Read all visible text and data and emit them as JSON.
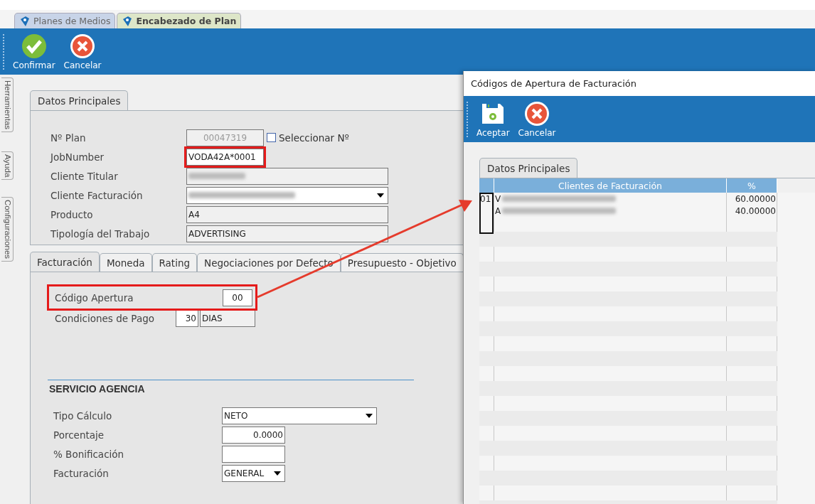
{
  "document_tabs": [
    {
      "label": "Planes de Medios",
      "selected": false
    },
    {
      "label": "Encabezado de Plan",
      "selected": true
    }
  ],
  "toolbar": [
    {
      "label": "Confirmar",
      "kind": "confirm"
    },
    {
      "label": "Cancelar",
      "kind": "cancel"
    }
  ],
  "side_tabs": [
    "Herramientas",
    "Ayuda",
    "Configuraciones"
  ],
  "main_tab": {
    "label": "Datos Principales",
    "selected": true
  },
  "fields": [
    {
      "label": "Nº Plan",
      "kind": "readonly",
      "value": "00047319",
      "checkbox": {
        "label": "Seleccionar Nº",
        "checked": false
      }
    },
    {
      "label": "JobNumber",
      "kind": "input",
      "value": "VODA42A*0001",
      "highlighted": true
    },
    {
      "label": "Cliente Titular",
      "kind": "blurred"
    },
    {
      "label": "Cliente Facturación",
      "kind": "blurred_dropdown"
    },
    {
      "label": "Producto",
      "kind": "wide",
      "value": "A4"
    },
    {
      "label": "Tipología del Trabajo",
      "kind": "wide",
      "value": "ADVERTISING"
    }
  ],
  "section_tabs": [
    {
      "label": "Facturación",
      "selected": true
    },
    {
      "label": "Moneda",
      "selected": false
    },
    {
      "label": "Rating",
      "selected": false
    },
    {
      "label": "Negociaciones por Defecto",
      "selected": false
    },
    {
      "label": "Presupuesto - Objetivo",
      "selected": false
    }
  ],
  "billing_fields": [
    {
      "label": "Código Apertura",
      "kind": "code",
      "value": "00",
      "highlighted": true
    },
    {
      "label": "Condiciones de Pago",
      "kind": "terms",
      "value": "30",
      "unit": "DIAS"
    }
  ],
  "agency": {
    "title": "SERVICIO AGENCIA",
    "fields": [
      {
        "label": "Tipo Cálculo",
        "kind": "dropdown_wide",
        "value": "NETO"
      },
      {
        "label": "Porcentaje",
        "kind": "number",
        "value": "0.0000"
      },
      {
        "label": "% Bonificación",
        "kind": "number"
      },
      {
        "label": "Facturación",
        "kind": "dropdown",
        "value": "GENERAL"
      }
    ]
  },
  "dialog": {
    "title": "Códigos de Apertura de Facturación",
    "toolbar": [
      {
        "label": "Aceptar",
        "kind": "save"
      },
      {
        "label": "Cancelar",
        "kind": "cancel"
      }
    ],
    "tab": {
      "label": "Datos Principales",
      "selected": true
    },
    "table": {
      "columns": [
        "Clientes de Facturación",
        "%"
      ],
      "rows": [
        {
          "code": "01",
          "client": "V",
          "percent": "60.00000"
        },
        {
          "client": "A",
          "percent": "40.00000"
        }
      ]
    }
  }
}
